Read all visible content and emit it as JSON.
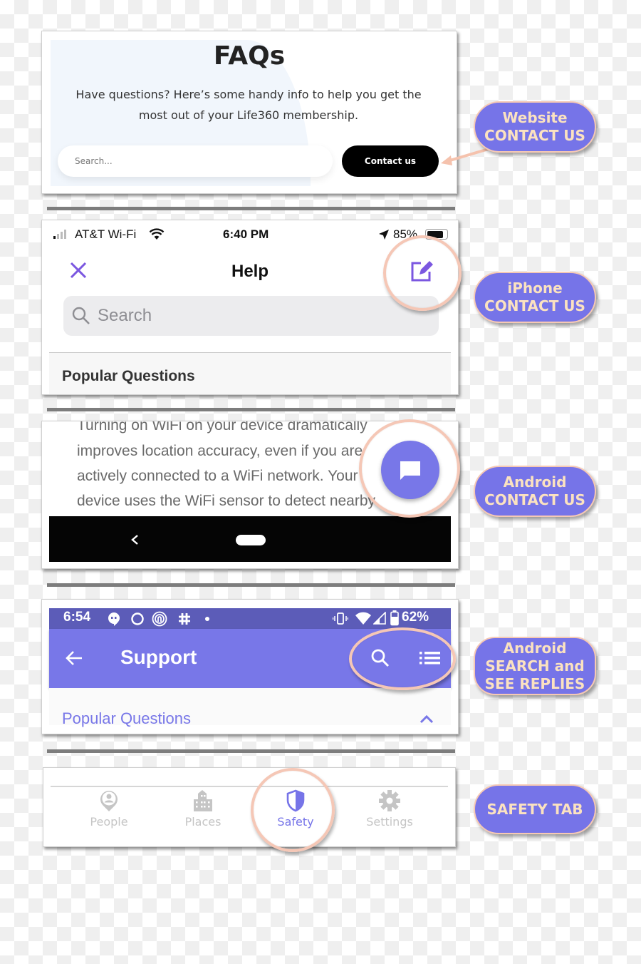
{
  "website": {
    "title": "FAQs",
    "subtitle_line1": "Have questions? Here’s some handy info to help you get the",
    "subtitle_line2": "most out of your Life360 membership.",
    "search_placeholder": "Search...",
    "contact_button": "Contact us"
  },
  "iphone": {
    "carrier": "AT&T Wi-Fi",
    "time": "6:40 PM",
    "battery": "85%",
    "title": "Help",
    "close_icon": "close-icon",
    "compose_icon": "compose-icon",
    "search_placeholder": "Search",
    "section_header": "Popular Questions"
  },
  "android_article": {
    "lines": [
      "Turning on WiFi on your device dramatically",
      "improves location accuracy, even if you are",
      "actively connected to a WiFi network. Your",
      "device uses the WiFi sensor to detect nearby"
    ],
    "fab_icon": "chat-icon",
    "nav_back_icon": "back-chevron-icon",
    "nav_home_icon": "home-pill-icon"
  },
  "android_support": {
    "time": "6:54",
    "battery": "62%",
    "title": "Support",
    "section_header": "Popular Questions",
    "accent": "#7877e8",
    "status_bar_color": "#5c5cb8"
  },
  "tabbar": {
    "tabs": [
      {
        "label": "People",
        "icon": "person-pin-icon",
        "active": false
      },
      {
        "label": "Places",
        "icon": "building-icon",
        "active": false
      },
      {
        "label": "Safety",
        "icon": "shield-icon",
        "active": true
      },
      {
        "label": "Settings",
        "icon": "gear-icon",
        "active": false
      }
    ],
    "active_color": "#7674e8",
    "inactive_color": "#c5c5c5"
  },
  "callouts": {
    "website": [
      "Website",
      "CONTACT US"
    ],
    "iphone": [
      "iPhone",
      "CONTACT US"
    ],
    "android_contact": [
      "Android",
      "CONTACT US"
    ],
    "android_search": [
      "Android",
      "SEARCH and",
      "SEE REPLIES"
    ],
    "safety": [
      "SAFETY TAB"
    ],
    "fill_color": "#7674e8",
    "text_color": "#fbe2c0",
    "ring_color": "#f5c7b6"
  }
}
